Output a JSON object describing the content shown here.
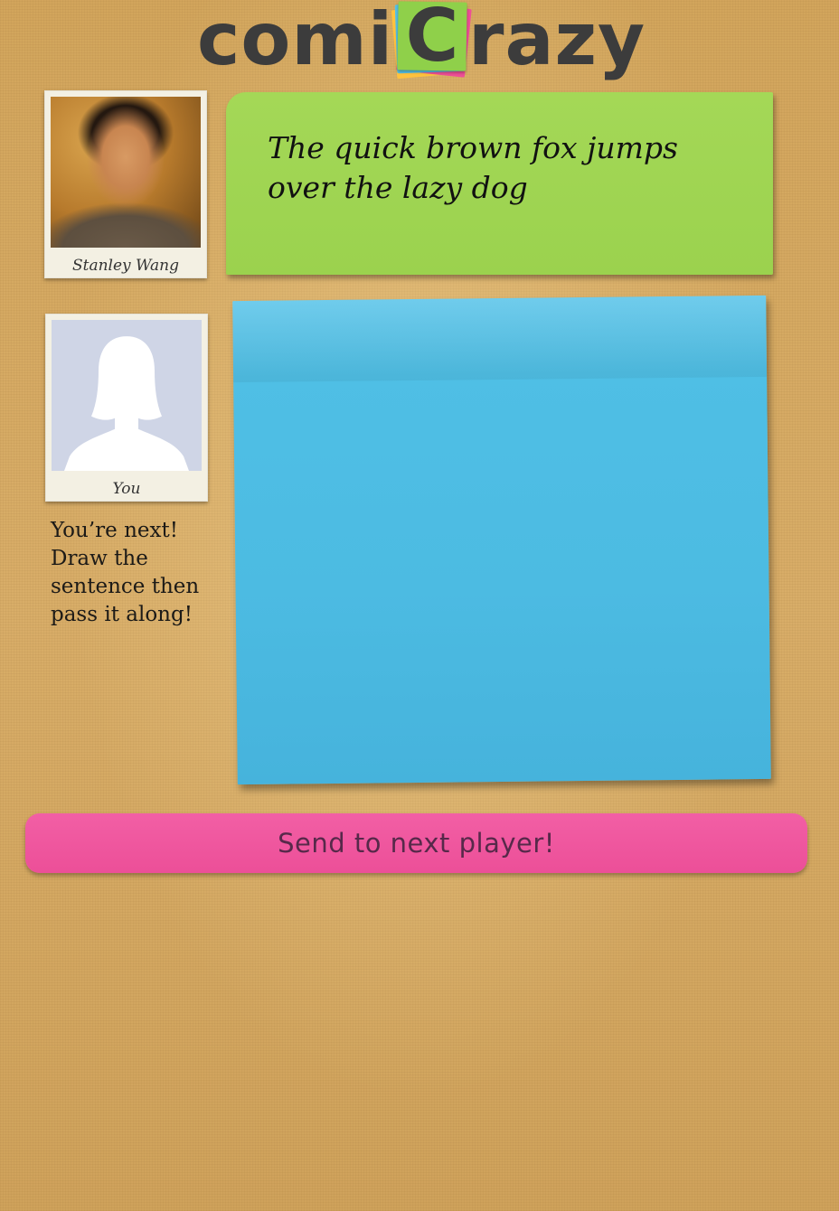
{
  "app": {
    "logo_left": "comi",
    "logo_letter": "C",
    "logo_right": "razy",
    "colors": {
      "background": "#d5a963",
      "prompt_note": "#9bd24e",
      "canvas_note": "#4fbfe5",
      "send_button": "#ec4f98",
      "logo_text": "#3c3c3c"
    }
  },
  "players": [
    {
      "name": "Stanley Wang",
      "photo": "user-photo"
    },
    {
      "name": "You",
      "photo": "default-avatar-icon"
    }
  ],
  "instructions": "You’re next! Draw the sentence then pass it along!",
  "prompt": {
    "sentence": "The quick brown fox jumps over the lazy dog"
  },
  "actions": {
    "send_label": "Send to next player!"
  }
}
